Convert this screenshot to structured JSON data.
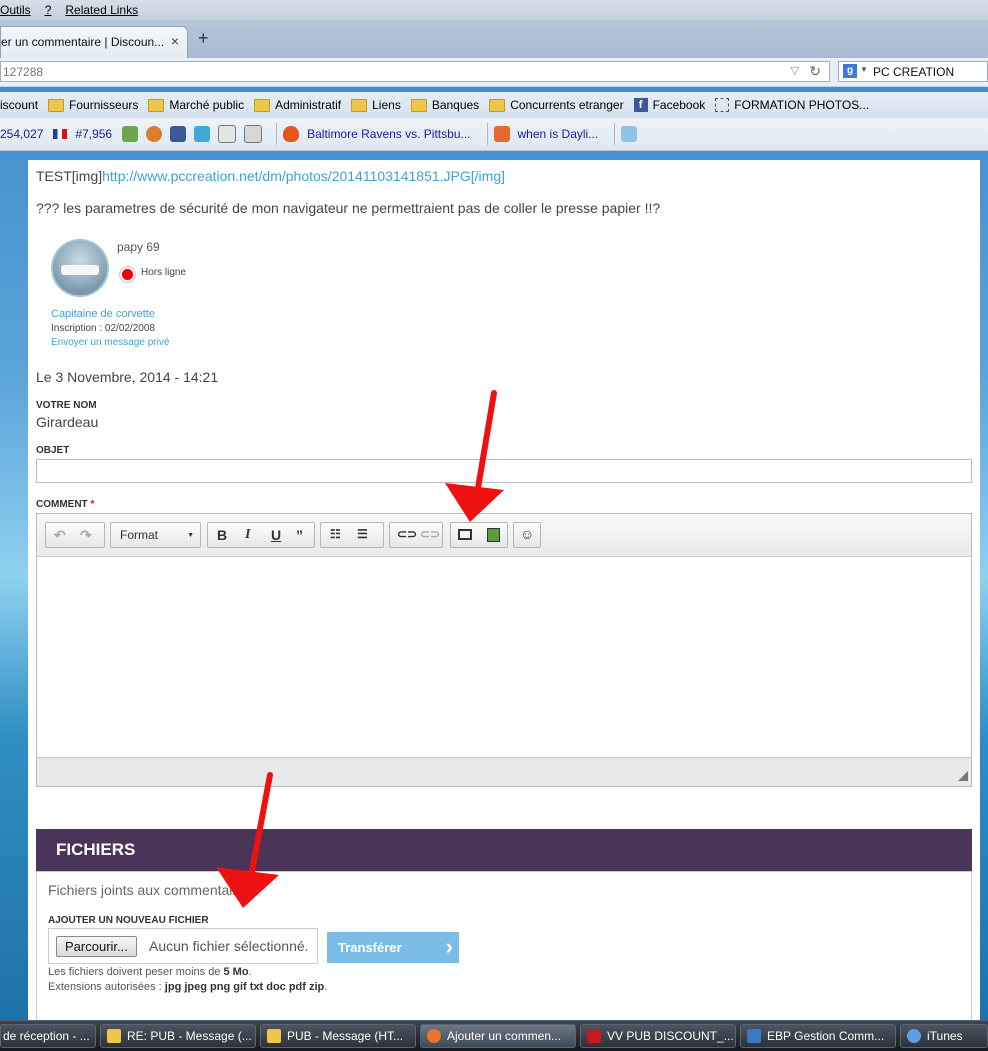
{
  "browser": {
    "menu": [
      "Outils",
      "?",
      "Related Links"
    ],
    "tab_title": "er un commentaire | Discoun...",
    "tab_close": "×",
    "new_tab": "+",
    "url": "127288",
    "search_value": "PC CREATION"
  },
  "bookmarks": [
    "iscount",
    "Fournisseurs",
    "Marché public",
    "Administratif",
    "Liens",
    "Banques",
    "Concurrents etranger",
    "Facebook",
    "FORMATION PHOTOS..."
  ],
  "toolbar": {
    "rank1": "254,027",
    "rank2": "#7,956",
    "news1": "Baltimore Ravens vs. Pittsbu...",
    "news2": "when is Dayli..."
  },
  "comment": {
    "test_prefix": "TEST[img]",
    "link": "http://www.pccreation.net/dm/photos/20141103141851.JPG[/img]",
    "message": "??? les parametres de sécurité de mon navigateur ne permettraient pas de coller le presse papier !!?"
  },
  "user": {
    "name": "papy 69",
    "status": "Hors ligne",
    "rank": "Capitaine de corvette",
    "inscription": "Inscription : 02/02/2008",
    "pm": "Envoyer un message privé"
  },
  "date": "Le 3 Novembre, 2014 - 14:21",
  "form": {
    "name_label": "VOTRE NOM",
    "name_value": "Girardeau",
    "subject_label": "OBJET",
    "comment_label": "COMMENT",
    "required_mark": "*",
    "format_label": "Format"
  },
  "files": {
    "title": "FICHIERS",
    "description": "Fichiers joints aux commentaires",
    "add_label": "AJOUTER UN NOUVEAU FICHIER",
    "browse": "Parcourir...",
    "no_file": "Aucun fichier sélectionné.",
    "upload": "Transférer",
    "limit_prefix": "Les fichiers doivent peser moins de ",
    "limit_value": "5 Mo",
    "limit_suffix": ".",
    "ext_prefix": "Extensions autorisées : ",
    "ext_value": "jpg jpeg png gif txt doc pdf zip",
    "ext_suffix": "."
  },
  "taskbar": [
    {
      "label": "de réception - ...",
      "color": "#2b70c8"
    },
    {
      "label": "RE: PUB - Message (...",
      "color": "#f0c64a"
    },
    {
      "label": "PUB - Message (HT...",
      "color": "#f0c64a"
    },
    {
      "label": "Ajouter un commen...",
      "color": "#e8732a"
    },
    {
      "label": "VV PUB DISCOUNT_...",
      "color": "#c8181e"
    },
    {
      "label": "EBP Gestion Comm...",
      "color": "#3a78c2"
    },
    {
      "label": "iTunes",
      "color": "#5aa0e0"
    }
  ],
  "colors": {
    "link": "#3ea1d6",
    "files_header": "#4a3558",
    "upload_button": "#7bbde6",
    "arrow": "#ee1111"
  }
}
